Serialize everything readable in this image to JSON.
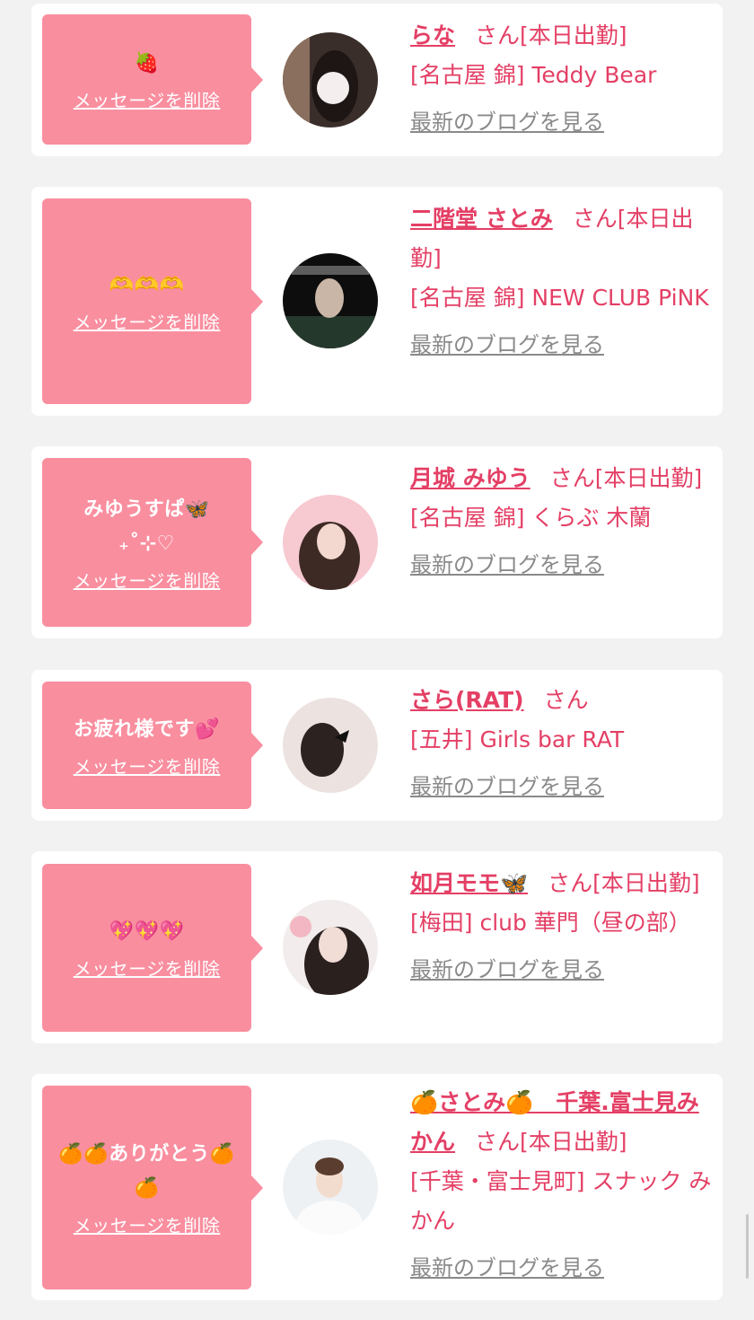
{
  "colors": {
    "bubble": "#f98e9f",
    "accent": "#e43f65",
    "link_gray": "#8a8a8a",
    "background": "#f2f2f2"
  },
  "labels": {
    "delete": "メッセージを削除",
    "blog": "最新のブログを見る",
    "san": "さん"
  },
  "cards": [
    {
      "message": "🍓",
      "name": "らな",
      "status": "[本日出勤]",
      "shop": "[名古屋 錦] Teddy Bear",
      "avatar_icon": "avatar-photo"
    },
    {
      "message": "🫶🫶🫶",
      "name": "二階堂 さとみ",
      "status": "[本日出勤]",
      "shop": "[名古屋 錦] NEW CLUB PiNK",
      "avatar_icon": "avatar-photo"
    },
    {
      "message": "みゆうすぱ🦋 ₊˚⊹♡",
      "name": "月城 みゆう",
      "status": "[本日出勤]",
      "shop": "[名古屋 錦] くらぶ 木蘭",
      "avatar_icon": "avatar-photo"
    },
    {
      "message": "お疲れ様です💕",
      "name": "さら(RAT)",
      "status": "",
      "shop": "[五井] Girls bar RAT",
      "avatar_icon": "avatar-photo"
    },
    {
      "message": "💖💖💖",
      "name": "如月モモ🦋",
      "status": "[本日出勤]",
      "shop": "[梅田] club 華門（昼の部）",
      "avatar_icon": "avatar-photo"
    },
    {
      "message": "🍊🍊ありがとう🍊🍊",
      "name": "🍊さとみ🍊　千葉.富士見みかん",
      "status": "[本日出勤]",
      "shop": "[千葉・富士見町] スナック みかん",
      "avatar_icon": "avatar-photo"
    }
  ]
}
